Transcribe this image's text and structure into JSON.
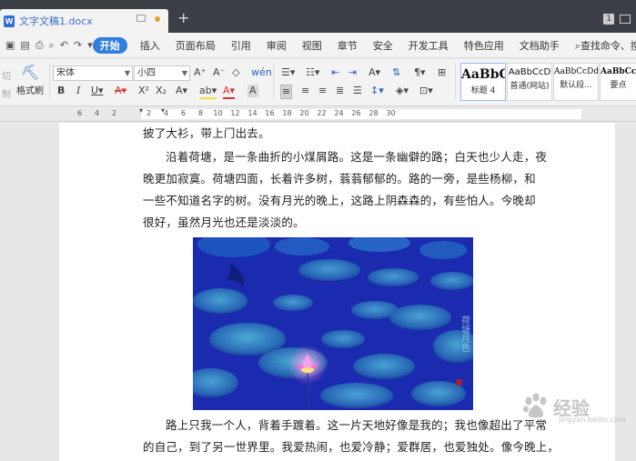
{
  "titlebar": {
    "doc_title": "文字文稿1.docx",
    "new_tab": "+",
    "page_badge": "1"
  },
  "menubar": {
    "items": [
      "开始",
      "插入",
      "页面布局",
      "引用",
      "审阅",
      "视图",
      "章节",
      "安全",
      "开发工具",
      "特色应用",
      "文档助手"
    ],
    "active": "开始",
    "search": "查找命令、搜"
  },
  "ribbon": {
    "cut_label": "切",
    "copy_label": "制",
    "format_painter_label": "格式刷",
    "font_name": "宋体",
    "font_size": "小四",
    "styles": [
      {
        "sample": "AaBbC",
        "name": "标题 4"
      },
      {
        "sample": "AaBbCcD",
        "name": "普通(网站)"
      },
      {
        "sample": "AaBbCcDd",
        "name": "默认段..."
      },
      {
        "sample": "AaBbCcDd",
        "name": "要点"
      }
    ]
  },
  "ruler": {
    "numbers": [
      "6",
      "4",
      "2",
      "",
      "2",
      "4",
      "6",
      "8",
      "10",
      "12",
      "14",
      "16",
      "18",
      "20",
      "22",
      "24",
      "26",
      "28",
      "30"
    ]
  },
  "document": {
    "line_1": "披了大衫，带上门出去。",
    "para_2": [
      "沿着荷塘，是一条曲折的小煤屑路。这是一条幽僻的路；白天也少人走，夜",
      "晚更加寂寞。荷塘四面，长着许多树，蓊蓊郁郁的。路的一旁，是些杨柳，和",
      "一些不知道名字的树。没有月光的晚上，这路上阴森森的，有些怕人。今晚却",
      "很好，虽然月光也还是淡淡的。"
    ],
    "para_3": [
      "路上只我一个人，背着手踱着。这一片天地好像是我的；我也像超出了平常",
      "的自己，到了另一世界里。我爱热闹，也爱冷静；爱群居，也爱独处。像今晚上，"
    ],
    "image_stamp": "荷塘月色"
  },
  "watermark": {
    "text": "经验",
    "sub": "jingyan.baidu.com"
  },
  "colors": {
    "accent": "#2f7ee0",
    "tabbar": "#3a3e45",
    "doc_title": "#3e6fc9",
    "modified_dot": "#f29a2e"
  }
}
